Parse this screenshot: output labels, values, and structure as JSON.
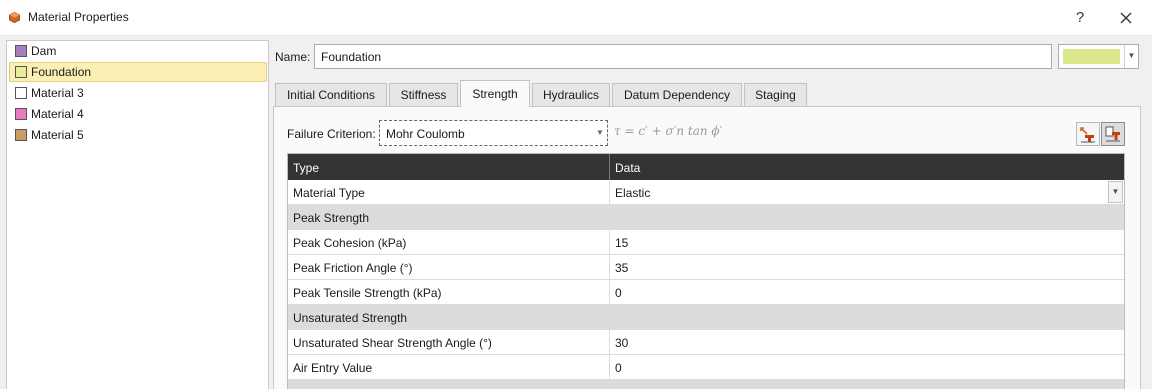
{
  "window": {
    "title": "Material Properties",
    "help_label": "?"
  },
  "materials": [
    {
      "label": "Dam",
      "color": "#a77fc0",
      "selected": false
    },
    {
      "label": "Foundation",
      "color": "#e6ec9a",
      "selected": true
    },
    {
      "label": "Material 3",
      "color": "#ffffff",
      "selected": false
    },
    {
      "label": "Material 4",
      "color": "#e87ac0",
      "selected": false
    },
    {
      "label": "Material 5",
      "color": "#cc9c68",
      "selected": false
    }
  ],
  "name_field": {
    "label": "Name:",
    "value": "Foundation",
    "color": "#dce68a"
  },
  "tabs": [
    {
      "label": "Initial Conditions",
      "active": false
    },
    {
      "label": "Stiffness",
      "active": false
    },
    {
      "label": "Strength",
      "active": true
    },
    {
      "label": "Hydraulics",
      "active": false
    },
    {
      "label": "Datum Dependency",
      "active": false
    },
    {
      "label": "Staging",
      "active": false
    }
  ],
  "failure_criterion": {
    "label": "Failure Criterion:",
    "value": "Mohr Coulomb",
    "formula": "τ = c′ + σ′n tan ϕ′"
  },
  "grid": {
    "headers": {
      "type": "Type",
      "data": "Data"
    },
    "rows": [
      {
        "type": "Material Type",
        "data": "Elastic",
        "dropdown": true
      },
      {
        "type": "Peak Strength",
        "section": true
      },
      {
        "type": "Peak Cohesion (kPa)",
        "data": "15"
      },
      {
        "type": "Peak Friction Angle (°)",
        "data": "35"
      },
      {
        "type": "Peak Tensile Strength (kPa)",
        "data": "0"
      },
      {
        "type": "Unsaturated Strength",
        "section": true
      },
      {
        "type": "Unsaturated Shear Strength Angle (°)",
        "data": "30"
      },
      {
        "type": "Air Entry Value",
        "data": "0"
      }
    ]
  },
  "colors": {
    "header_bg": "#333333",
    "section_bg": "#dcdcdc",
    "selection_bg": "#fcefb4"
  }
}
